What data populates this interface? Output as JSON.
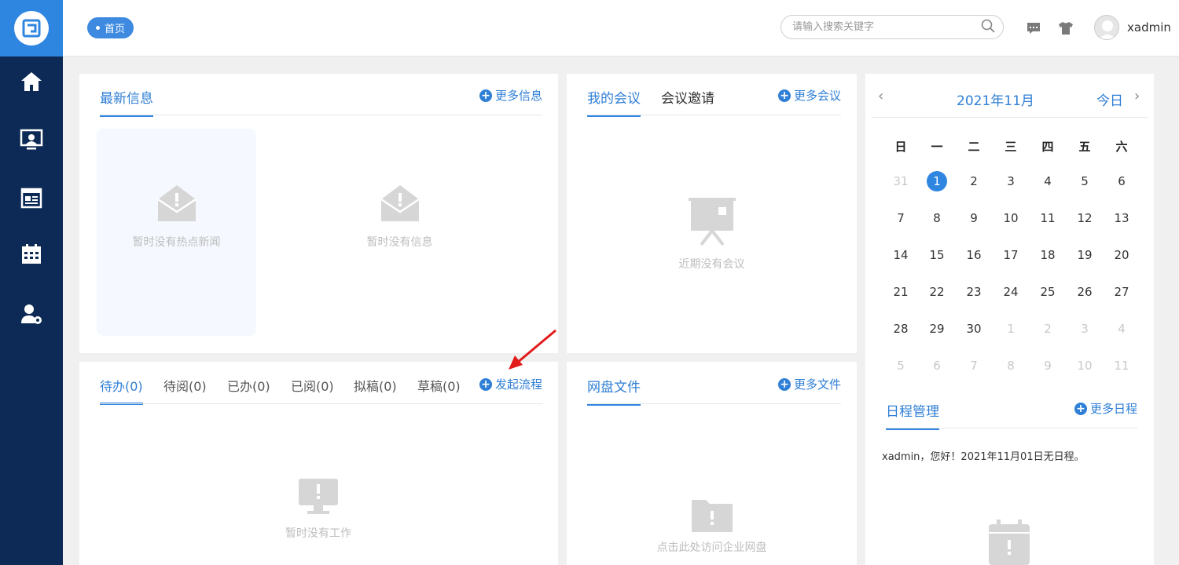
{
  "header": {
    "home_tab": "首页",
    "search_placeholder": "请输入搜索关键字",
    "username": "xadmin"
  },
  "news": {
    "title": "最新信息",
    "more": "更多信息",
    "empty_hot": "暂时没有热点新闻",
    "empty_info": "暂时没有信息"
  },
  "meetings": {
    "tabs": [
      "我的会议",
      "会议邀请"
    ],
    "more": "更多会议",
    "empty": "近期没有会议"
  },
  "work": {
    "tabs": [
      "待办(0)",
      "待阅(0)",
      "已办(0)",
      "已阅(0)",
      "拟稿(0)",
      "草稿(0)"
    ],
    "start_flow": "发起流程",
    "empty": "暂时没有工作"
  },
  "files": {
    "title": "网盘文件",
    "more": "更多文件",
    "empty": "点击此处访问企业网盘"
  },
  "calendar": {
    "month": "2021年11月",
    "today_btn": "今日",
    "weekdays": [
      "日",
      "一",
      "二",
      "三",
      "四",
      "五",
      "六"
    ],
    "weeks": [
      [
        {
          "d": "31",
          "dim": true
        },
        {
          "d": "1",
          "today": true
        },
        {
          "d": "2"
        },
        {
          "d": "3"
        },
        {
          "d": "4"
        },
        {
          "d": "5"
        },
        {
          "d": "6"
        }
      ],
      [
        {
          "d": "7"
        },
        {
          "d": "8"
        },
        {
          "d": "9"
        },
        {
          "d": "10"
        },
        {
          "d": "11"
        },
        {
          "d": "12"
        },
        {
          "d": "13"
        }
      ],
      [
        {
          "d": "14"
        },
        {
          "d": "15"
        },
        {
          "d": "16"
        },
        {
          "d": "17"
        },
        {
          "d": "18"
        },
        {
          "d": "19"
        },
        {
          "d": "20"
        }
      ],
      [
        {
          "d": "21"
        },
        {
          "d": "22"
        },
        {
          "d": "23"
        },
        {
          "d": "24"
        },
        {
          "d": "25"
        },
        {
          "d": "26"
        },
        {
          "d": "27"
        }
      ],
      [
        {
          "d": "28"
        },
        {
          "d": "29"
        },
        {
          "d": "30"
        },
        {
          "d": "1",
          "dim": true
        },
        {
          "d": "2",
          "dim": true
        },
        {
          "d": "3",
          "dim": true
        },
        {
          "d": "4",
          "dim": true
        }
      ],
      [
        {
          "d": "5",
          "dim": true
        },
        {
          "d": "6",
          "dim": true
        },
        {
          "d": "7",
          "dim": true
        },
        {
          "d": "8",
          "dim": true
        },
        {
          "d": "9",
          "dim": true
        },
        {
          "d": "10",
          "dim": true
        },
        {
          "d": "11",
          "dim": true
        }
      ]
    ]
  },
  "schedule": {
    "title": "日程管理",
    "more": "更多日程",
    "message": "xadmin，您好！2021年11月01日无日程。"
  },
  "colors": {
    "sidebar": "#0c2a55",
    "accent": "#2f86e0"
  }
}
